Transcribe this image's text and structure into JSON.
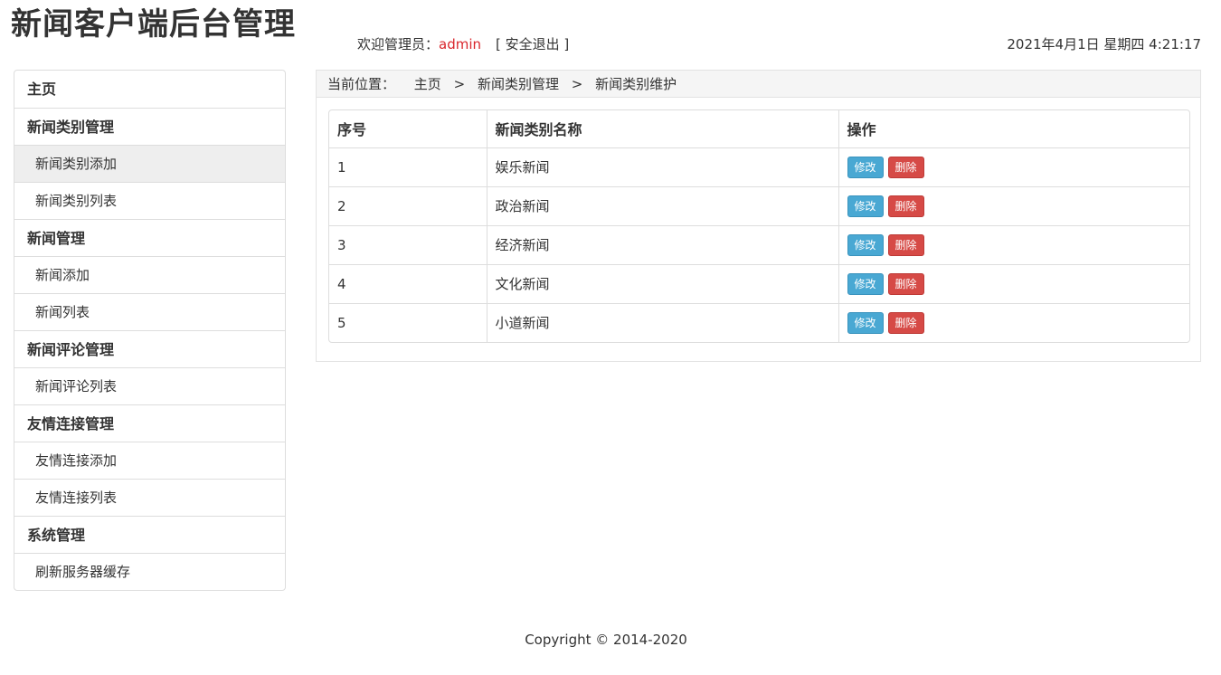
{
  "header": {
    "title": "新闻客户端后台管理",
    "welcome_label": "欢迎管理员：",
    "username": "admin",
    "logout_label": "[ 安全退出 ]",
    "datetime": "2021年4月1日 星期四 4:21:17"
  },
  "sidebar": {
    "home": "主页",
    "group_category": "新闻类别管理",
    "item_category_add": "新闻类别添加",
    "item_category_list": "新闻类别列表",
    "group_news": "新闻管理",
    "item_news_add": "新闻添加",
    "item_news_list": "新闻列表",
    "group_comment": "新闻评论管理",
    "item_comment_list": "新闻评论列表",
    "group_link": "友情连接管理",
    "item_link_add": "友情连接添加",
    "item_link_list": "友情连接列表",
    "group_system": "系统管理",
    "item_refresh_cache": "刷新服务器缓存"
  },
  "breadcrumb": {
    "label": "当前位置：",
    "home": "主页",
    "separator": ">",
    "category_mgmt": "新闻类别管理",
    "current": "新闻类别维护"
  },
  "table": {
    "headers": {
      "num": "序号",
      "name": "新闻类别名称",
      "action": "操作"
    },
    "rows": [
      {
        "num": "1",
        "name": "娱乐新闻"
      },
      {
        "num": "2",
        "name": "政治新闻"
      },
      {
        "num": "3",
        "name": "经济新闻"
      },
      {
        "num": "4",
        "name": "文化新闻"
      },
      {
        "num": "5",
        "name": "小道新闻"
      }
    ],
    "edit_label": "修改",
    "delete_label": "删除"
  },
  "footer": {
    "copyright": "Copyright © 2014-2020"
  },
  "colors": {
    "username": "#d9262c",
    "edit_button": "#49a8d3",
    "delete_button": "#d64a46"
  }
}
